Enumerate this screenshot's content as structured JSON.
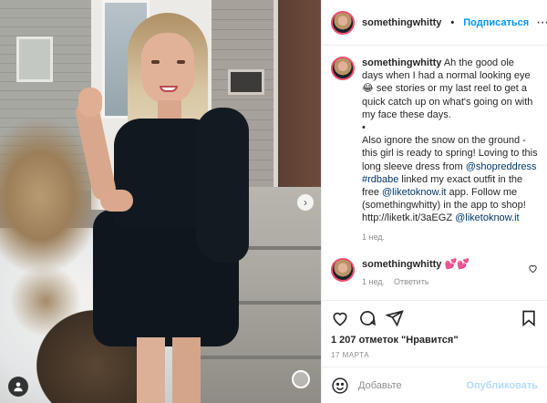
{
  "post": {
    "username": "somethingwhitty",
    "follow_label": "Подписаться",
    "caption_parts": {
      "p1": "Ah the good ole days when I had a normal looking eye 😂 see stories or my last reel to get a quick catch up on what's going on with my face these days.",
      "bullet": "•",
      "p2": "Also ignore the snow on the ground - this girl is ready to spring! Loving to this long sleeve dress from ",
      "mention1": "@shopreddress",
      "tag1": "#rdbabe",
      "p3": " linked my exact outfit in the free ",
      "mention2": "@liketoknow.it",
      "p4": " app. Follow me (somethingwhitty) in the app to shop! http://liketk.it/3aEGZ ",
      "mention3": "@liketoknow.it"
    },
    "caption_time": "1 нед.",
    "comment": {
      "username": "somethingwhitty",
      "text": "💕💕",
      "time": "1 нед.",
      "reply_label": "Ответить"
    },
    "likes": "1 207 отметок \"Нравится\"",
    "date": "17 МАРТА",
    "add_placeholder": "Добавьте",
    "publish_label": "Опубликовать"
  },
  "icons": {
    "more": "more-icon",
    "heart": "heart-icon",
    "comment": "comment-icon",
    "share": "share-icon",
    "save": "bookmark-icon",
    "emoji": "emoji-icon",
    "tag": "person-tag-icon",
    "next": "chevron-right-icon"
  },
  "colors": {
    "accent": "#0095f6",
    "link": "#00376b",
    "muted": "#8e8e8e",
    "publish_disabled": "#b3dbff"
  }
}
